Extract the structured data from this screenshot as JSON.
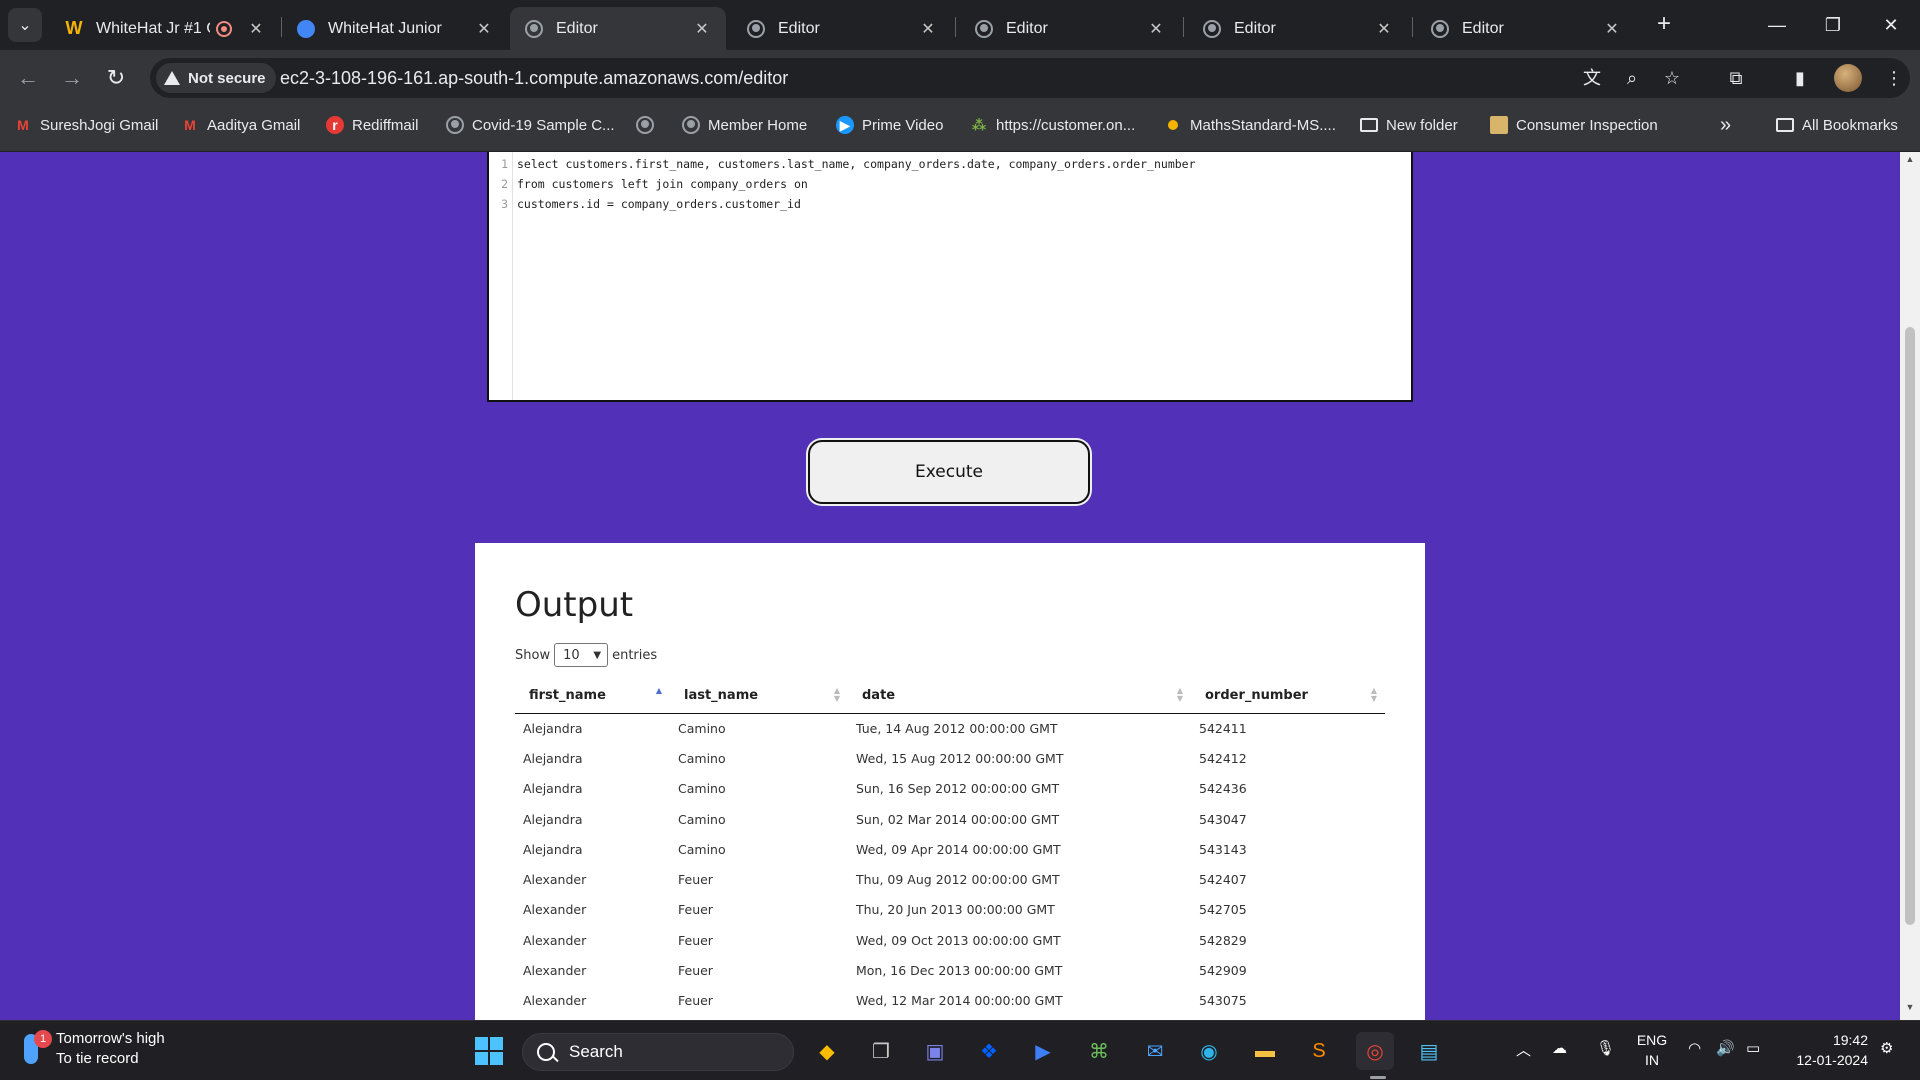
{
  "browser": {
    "tabs": [
      {
        "title": "WhiteHat Jr #1 C",
        "active": false
      },
      {
        "title": "WhiteHat Junior",
        "active": false
      },
      {
        "title": "Editor",
        "active": true
      },
      {
        "title": "Editor",
        "active": false
      },
      {
        "title": "Editor",
        "active": false
      },
      {
        "title": "Editor",
        "active": false
      },
      {
        "title": "Editor",
        "active": false
      }
    ],
    "security_label": "Not secure",
    "url": "ec2-3-108-196-161.ap-south-1.compute.amazonaws.com/editor",
    "bookmarks": [
      "SureshJogi Gmail",
      "Aaditya Gmail",
      "Rediffmail",
      "Covid-19 Sample C...",
      "",
      "Member Home",
      "Prime Video",
      "https://customer.on...",
      "MathsStandard-MS....",
      "New folder",
      "Consumer Inspection"
    ],
    "overflow_label": "»",
    "all_bookmarks": "All Bookmarks"
  },
  "editor": {
    "lines": [
      {
        "num": "1",
        "code": "select customers.first_name, customers.last_name, company_orders.date, company_orders.order_number"
      },
      {
        "num": "2",
        "code": "from customers left join company_orders on"
      },
      {
        "num": "3",
        "code": "customers.id = company_orders.customer_id"
      }
    ]
  },
  "execute_label": "Execute",
  "output": {
    "title": "Output",
    "show_label": "Show",
    "entries_value": "10",
    "entries_label": "entries",
    "columns": [
      "first_name",
      "last_name",
      "date",
      "order_number"
    ],
    "rows": [
      [
        "Alejandra",
        "Camino",
        "Tue, 14 Aug 2012 00:00:00 GMT",
        "542411"
      ],
      [
        "Alejandra",
        "Camino",
        "Wed, 15 Aug 2012 00:00:00 GMT",
        "542412"
      ],
      [
        "Alejandra",
        "Camino",
        "Sun, 16 Sep 2012 00:00:00 GMT",
        "542436"
      ],
      [
        "Alejandra",
        "Camino",
        "Sun, 02 Mar 2014 00:00:00 GMT",
        "543047"
      ],
      [
        "Alejandra",
        "Camino",
        "Wed, 09 Apr 2014 00:00:00 GMT",
        "543143"
      ],
      [
        "Alexander",
        "Feuer",
        "Thu, 09 Aug 2012 00:00:00 GMT",
        "542407"
      ],
      [
        "Alexander",
        "Feuer",
        "Thu, 20 Jun 2013 00:00:00 GMT",
        "542705"
      ],
      [
        "Alexander",
        "Feuer",
        "Wed, 09 Oct 2013 00:00:00 GMT",
        "542829"
      ],
      [
        "Alexander",
        "Feuer",
        "Mon, 16 Dec 2013 00:00:00 GMT",
        "542909"
      ],
      [
        "Alexander",
        "Feuer",
        "Wed, 12 Mar 2014 00:00:00 GMT",
        "543075"
      ]
    ]
  },
  "taskbar": {
    "weather_badge": "1",
    "weather_line1": "Tomorrow's high",
    "weather_line2": "To tie record",
    "search_label": "Search",
    "lang_line1": "ENG",
    "lang_line2": "IN",
    "time": "19:42",
    "date": "12-01-2024"
  },
  "colors": {
    "page_background": "#5230b8",
    "browser_frame": "#202124",
    "toolbar": "#35363a"
  }
}
